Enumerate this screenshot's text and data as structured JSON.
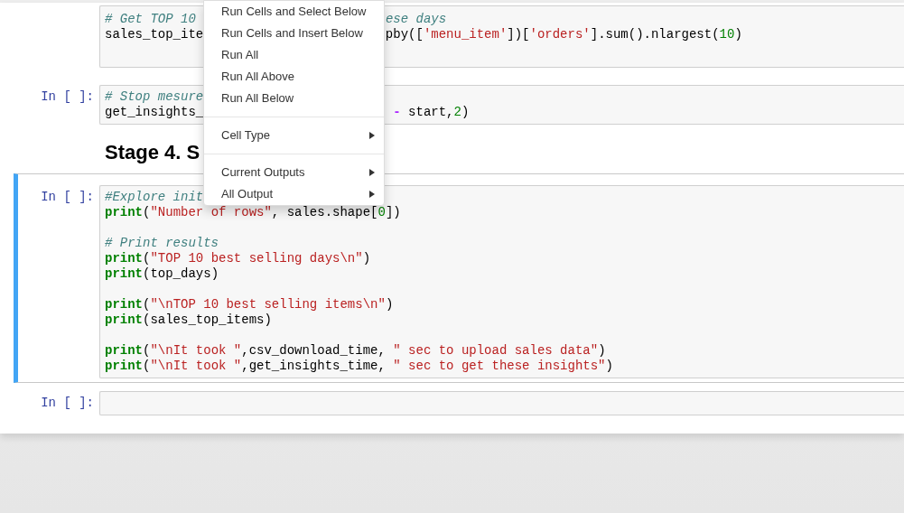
{
  "cells": [
    {
      "selected": false,
      "blocks": [
        [
          {
            "tokens": [
              {
                "kind": "comment",
                "text": "# Get TOP 10"
              }
            ],
            "tail": [
              {
                "kind": "comment",
                "text": "ese days"
              }
            ]
          },
          {
            "tokens": [
              {
                "kind": "plain",
                "text": "sales_top_ite"
              }
            ],
            "tail": [
              {
                "kind": "plain",
                "text": "pby(["
              },
              {
                "kind": "string",
                "text": "'menu_item'"
              },
              {
                "kind": "plain",
                "text": "])["
              },
              {
                "kind": "string",
                "text": "'orders'"
              },
              {
                "kind": "plain",
                "text": "].sum().nlargest("
              },
              {
                "kind": "number",
                "text": "10"
              },
              {
                "kind": "plain",
                "text": ")"
              }
            ]
          }
        ]
      ]
    },
    {
      "prompt": "In [ ]:",
      "selected": false,
      "blocks": [
        [
          {
            "tokens": [
              {
                "kind": "comment",
                "text": "# Stop mesure"
              }
            ]
          },
          {
            "tokens": [
              {
                "kind": "plain",
                "text": "get_insights_"
              }
            ],
            "tail": [
              {
                "kind": "operator",
                "text": " -"
              },
              {
                "kind": "plain",
                "text": " start,"
              },
              {
                "kind": "number",
                "text": "2"
              },
              {
                "kind": "plain",
                "text": ")"
              }
            ]
          }
        ]
      ]
    },
    {
      "kind": "heading",
      "text": "Stage 4. S"
    },
    {
      "prompt": "In [ ]:",
      "selected": true,
      "blocks": [
        [
          {
            "tokens": [
              {
                "kind": "comment",
                "text": "#Explore init"
              }
            ]
          },
          {
            "tokens": [
              {
                "kind": "keyword",
                "text": "print"
              },
              {
                "kind": "plain",
                "text": "("
              },
              {
                "kind": "string",
                "text": "\"Number of rows\""
              },
              {
                "kind": "plain",
                "text": ", sales.shape["
              },
              {
                "kind": "number",
                "text": "0"
              },
              {
                "kind": "plain",
                "text": "])"
              }
            ]
          }
        ],
        [
          {
            "tokens": [
              {
                "kind": "comment",
                "text": "# Print results"
              }
            ]
          },
          {
            "tokens": [
              {
                "kind": "keyword",
                "text": "print"
              },
              {
                "kind": "plain",
                "text": "("
              },
              {
                "kind": "string",
                "text": "\"TOP 10 best selling days\\n\""
              },
              {
                "kind": "plain",
                "text": ")"
              }
            ]
          },
          {
            "tokens": [
              {
                "kind": "keyword",
                "text": "print"
              },
              {
                "kind": "plain",
                "text": "(top_days)"
              }
            ]
          }
        ],
        [
          {
            "tokens": [
              {
                "kind": "keyword",
                "text": "print"
              },
              {
                "kind": "plain",
                "text": "("
              },
              {
                "kind": "string",
                "text": "\"\\nTOP 10 best selling items\\n\""
              },
              {
                "kind": "plain",
                "text": ")"
              }
            ]
          },
          {
            "tokens": [
              {
                "kind": "keyword",
                "text": "print"
              },
              {
                "kind": "plain",
                "text": "(sales_top_items)"
              }
            ]
          }
        ],
        [
          {
            "tokens": [
              {
                "kind": "keyword",
                "text": "print"
              },
              {
                "kind": "plain",
                "text": "("
              },
              {
                "kind": "string",
                "text": "\"\\nIt took \""
              },
              {
                "kind": "plain",
                "text": ",csv_download_time, "
              },
              {
                "kind": "string",
                "text": "\" sec to upload sales data\""
              },
              {
                "kind": "plain",
                "text": ")"
              }
            ]
          },
          {
            "tokens": [
              {
                "kind": "keyword",
                "text": "print"
              },
              {
                "kind": "plain",
                "text": "("
              },
              {
                "kind": "string",
                "text": "\"\\nIt took \""
              },
              {
                "kind": "plain",
                "text": ",get_insights_time, "
              },
              {
                "kind": "string",
                "text": "\" sec to get these insights\""
              },
              {
                "kind": "plain",
                "text": ")"
              }
            ]
          }
        ]
      ]
    },
    {
      "prompt": "In [ ]:",
      "selected": false
    }
  ],
  "menu": [
    {
      "kind": "item",
      "label": "Run Cells and Select Below"
    },
    {
      "kind": "item",
      "label": "Run Cells and Insert Below"
    },
    {
      "kind": "item",
      "label": "Run All"
    },
    {
      "kind": "item",
      "label": "Run All Above"
    },
    {
      "kind": "item",
      "label": "Run All Below"
    },
    {
      "kind": "divider"
    },
    {
      "kind": "submenu",
      "label": "Cell Type"
    },
    {
      "kind": "divider"
    },
    {
      "kind": "submenu",
      "label": "Current Outputs"
    },
    {
      "kind": "submenu",
      "label": "All Output"
    }
  ]
}
